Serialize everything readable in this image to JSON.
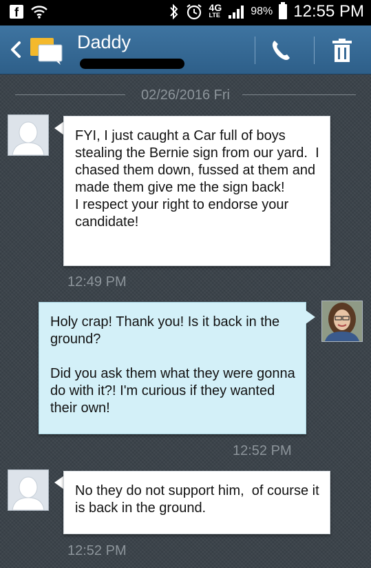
{
  "status_bar": {
    "network": "4G",
    "network_sub": "LTE",
    "battery": "98%",
    "time": "12:55 PM"
  },
  "header": {
    "contact_name": "Daddy"
  },
  "date_separator": "02/26/2016 Fri",
  "messages": [
    {
      "direction": "incoming",
      "text": "FYI, I just caught a Car full of boys stealing the Bernie sign from our yard.  I chased them down, fussed at them and made them give me the sign back!\nI respect your right to endorse your candidate!",
      "time": "12:49 PM"
    },
    {
      "direction": "outgoing",
      "text": "Holy crap! Thank you! Is it back in the ground?\n\nDid you ask them what they were gonna do with it?! I'm curious if they wanted their own!",
      "time": "12:52 PM"
    },
    {
      "direction": "incoming",
      "text": "No they do not support him,  of course it is back in the ground.",
      "time": "12:52 PM"
    }
  ],
  "colors": {
    "header": "#3a6c97",
    "incoming_bubble": "#ffffff",
    "outgoing_bubble": "#d3f0f8",
    "timestamp": "#8d959b"
  },
  "icons": [
    "facebook-icon",
    "wifi-icon",
    "bluetooth-icon",
    "alarm-icon",
    "signal-icon",
    "battery-icon",
    "back-icon",
    "messaging-icon",
    "call-icon",
    "delete-icon"
  ]
}
